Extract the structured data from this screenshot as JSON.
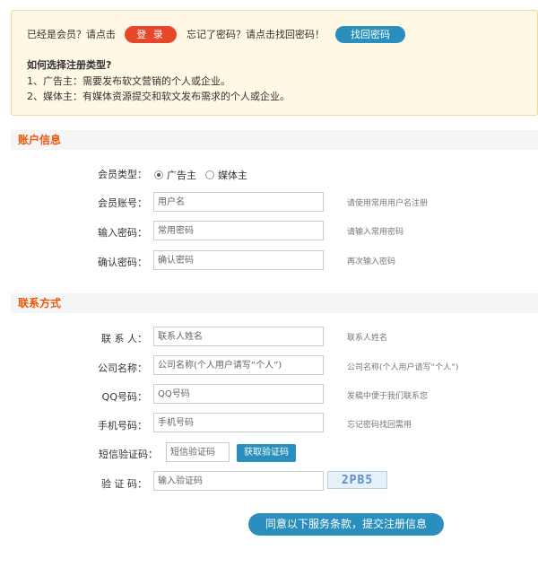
{
  "notice": {
    "already_member": "已经是会员？请点击",
    "login_label": "登 录",
    "forgot": "忘记了密码？请点击找回密码！",
    "recover_label": "找回密码",
    "how_to_title": "如何选择注册类型?",
    "line1": "1、广告主：需要发布软文营销的个人或企业。",
    "line2": "2、媒体主：有媒体资源提交和软文发布需求的个人或企业。"
  },
  "account": {
    "section_title": "账户信息",
    "member_type_label": "会员类型：",
    "type_options": [
      "广告主",
      "媒体主"
    ],
    "selected_type": "广告主",
    "account_label": "会员账号：",
    "account_placeholder": "用户名",
    "account_hint": "请使用常用用户名注册",
    "password_label": "输入密码：",
    "password_placeholder": "常用密码",
    "password_hint": "请输入常用密码",
    "confirm_label": "确认密码：",
    "confirm_placeholder": "确认密码",
    "confirm_hint": "再次输入密码"
  },
  "contact": {
    "section_title": "联系方式",
    "contact_label": "联 系 人：",
    "contact_placeholder": "联系人姓名",
    "contact_hint": "联系人姓名",
    "company_label": "公司名称：",
    "company_placeholder": "公司名称(个人用户请写“个人”)",
    "company_hint": "公司名称(个人用户请写“个人”)",
    "qq_label": "QQ号码：",
    "qq_placeholder": "QQ号码",
    "qq_hint": "发稿中便于我们联系您",
    "phone_label": "手机号码：",
    "phone_placeholder": "手机号码",
    "phone_hint": "忘记密码找回需用",
    "sms_label": "短信验证码：",
    "sms_placeholder": "短信验证码",
    "sms_button": "获取验证码",
    "captcha_label": "验 证 码：",
    "captcha_placeholder": "输入验证码",
    "captcha_image_text": "2PB5"
  },
  "submit_label": "同意以下服务条款，提交注册信息",
  "colors": {
    "accent_blue": "#2a8fbd",
    "accent_red": "#e8472b",
    "section_orange": "#e8590c"
  }
}
